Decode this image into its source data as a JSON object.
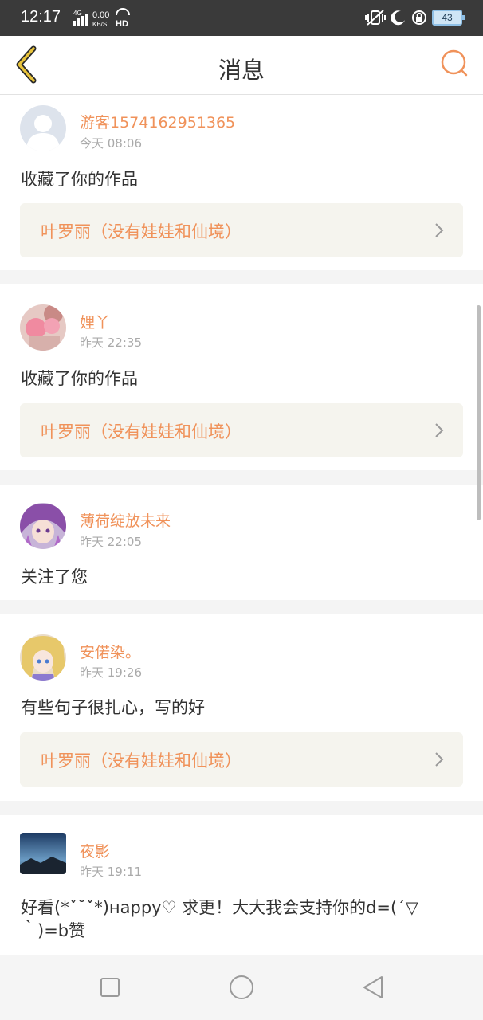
{
  "status_bar": {
    "time": "12:17",
    "network_type": "4G",
    "speed_value": "0.00",
    "speed_unit": "KB/S",
    "hd_label": "HD",
    "battery": "43"
  },
  "header": {
    "title": "消息",
    "back_icon": "chevron-left-icon",
    "search_icon": "search-icon"
  },
  "colors": {
    "accent": "#f0925a",
    "back_arrow": "#e8c33a",
    "link_bg": "#f5f4ee"
  },
  "messages": [
    {
      "username": "游客1574162951365",
      "time": "今天 08:06",
      "text": "收藏了你的作品",
      "work_title": "叶罗丽（没有娃娃和仙境）",
      "avatar": "default-avatar"
    },
    {
      "username": "娌丫",
      "time": "昨天 22:35",
      "text": "收藏了你的作品",
      "work_title": "叶罗丽（没有娃娃和仙境）",
      "avatar": "pink-bear-avatar"
    },
    {
      "username": "薄荷绽放未来",
      "time": "昨天 22:05",
      "text": "关注了您",
      "avatar": "anime-girl-avatar"
    },
    {
      "username": "安偌染。",
      "time": "昨天 19:26",
      "text": "有些句子很扎心，写的好",
      "work_title": "叶罗丽（没有娃娃和仙境）",
      "avatar": "anime-girl-avatar"
    },
    {
      "username": "夜影",
      "time": "昨天 19:11",
      "text": "好看(*ˇ˘ˇ*)нappy♡ 求更！大大我会支持你的d=(´▽｀)=b赞",
      "avatar": "landscape-avatar"
    }
  ],
  "nav_bar": {
    "recents_icon": "square-icon",
    "home_icon": "circle-icon",
    "back_icon": "triangle-back-icon"
  }
}
